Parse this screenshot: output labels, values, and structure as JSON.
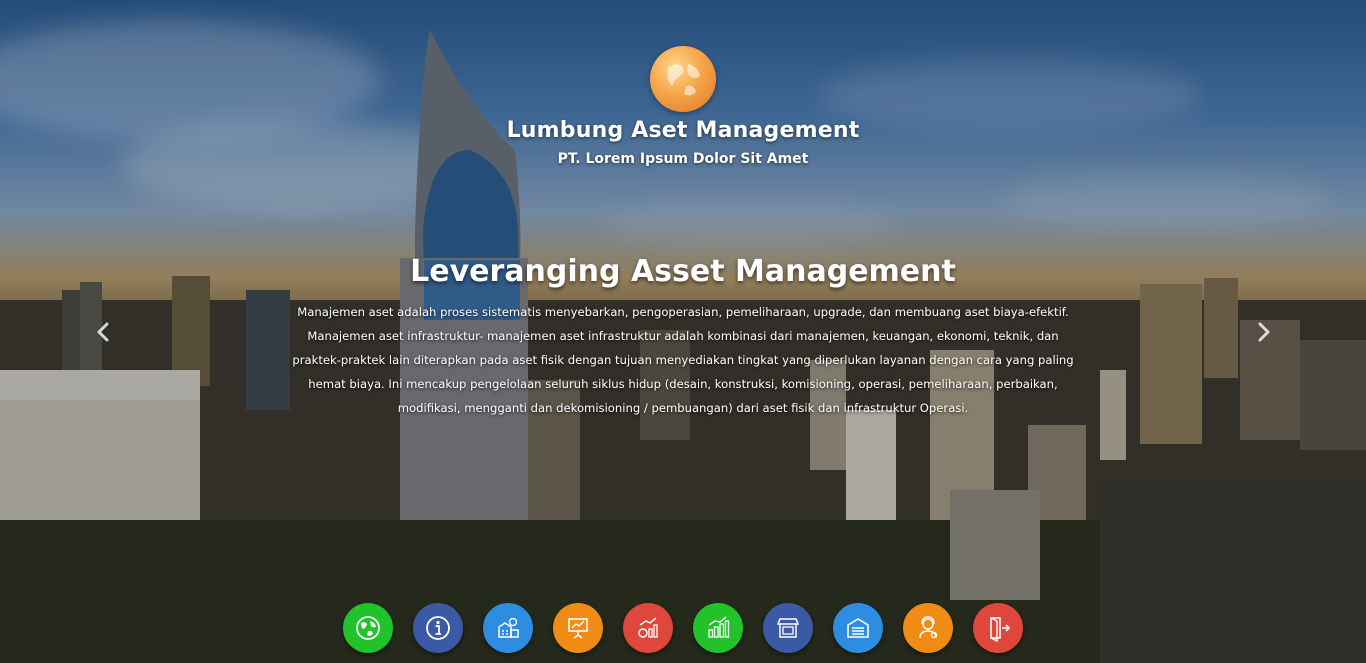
{
  "brand": {
    "title": "Lumbung Aset Management",
    "subtitle": "PT. Lorem Ipsum Dolor Sit Amet",
    "logo_icon": "globe-icon",
    "logo_color": "#f6a54b"
  },
  "hero": {
    "headline": "Leveranging Asset Management",
    "body": "Manajemen aset adalah proses sistematis menyebarkan, pengoperasian, pemeliharaan, upgrade, dan membuang aset biaya-efektif. Manajemen aset infrastruktur- manajemen aset infrastruktur adalah kombinasi dari manajemen, keuangan, ekonomi, teknik, dan praktek-praktek lain diterapkan pada aset fisik dengan tujuan menyediakan tingkat yang diperlukan layanan dengan cara yang paling hemat biaya. Ini mencakup pengelolaan seluruh siklus hidup (desain, konstruksi, komisioning, operasi, pemeliharaan, perbaikan, modifikasi, mengganti dan dekomisioning / pembuangan) dari aset fisik dan infrastruktur Operasi."
  },
  "carousel": {
    "prev_icon": "chevron-left-icon",
    "next_icon": "chevron-right-icon"
  },
  "nav_icons": [
    {
      "name": "world-icon",
      "color": "#22c32a"
    },
    {
      "name": "info-icon",
      "color": "#3b5aa6"
    },
    {
      "name": "property-icon",
      "color": "#2e8de0"
    },
    {
      "name": "presentation-icon",
      "color": "#f08c15"
    },
    {
      "name": "growth-chart-icon",
      "color": "#e0473c"
    },
    {
      "name": "bar-chart-icon",
      "color": "#22c32a"
    },
    {
      "name": "store-icon",
      "color": "#3b5aa6"
    },
    {
      "name": "warehouse-icon",
      "color": "#2e8de0"
    },
    {
      "name": "support-agent-icon",
      "color": "#f08c15"
    },
    {
      "name": "logout-icon",
      "color": "#e0473c"
    }
  ]
}
